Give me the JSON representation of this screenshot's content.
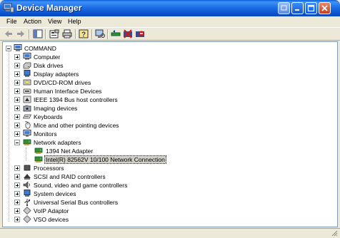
{
  "window": {
    "title": "Device Manager"
  },
  "menu": [
    "File",
    "Action",
    "View",
    "Help"
  ],
  "tree": {
    "root": "COMMAND",
    "categories": [
      {
        "label": "Computer",
        "icon": "computer-icon"
      },
      {
        "label": "Disk drives",
        "icon": "disk-drive-icon"
      },
      {
        "label": "Display adapters",
        "icon": "display-adapter-icon"
      },
      {
        "label": "DVD/CD-ROM drives",
        "icon": "cdrom-icon"
      },
      {
        "label": "Human Interface Devices",
        "icon": "hid-icon"
      },
      {
        "label": "IEEE 1394 Bus host controllers",
        "icon": "ieee1394-icon"
      },
      {
        "label": "Imaging devices",
        "icon": "camera-icon"
      },
      {
        "label": "Keyboards",
        "icon": "keyboard-icon"
      },
      {
        "label": "Mice and other pointing devices",
        "icon": "mouse-icon"
      },
      {
        "label": "Monitors",
        "icon": "monitor-icon"
      },
      {
        "label": "Network adapters",
        "icon": "network-adapter-icon",
        "expanded": true,
        "children": [
          {
            "label": "1394 Net Adapter",
            "icon": "network-card-icon"
          },
          {
            "label": "Intel(R) 82562V 10/100 Network Connection",
            "icon": "network-card-icon",
            "selected": true
          }
        ]
      },
      {
        "label": "Processors",
        "icon": "processor-icon"
      },
      {
        "label": "SCSI and RAID controllers",
        "icon": "scsi-icon"
      },
      {
        "label": "Sound, video and game controllers",
        "icon": "sound-icon"
      },
      {
        "label": "System devices",
        "icon": "system-device-icon"
      },
      {
        "label": "Universal Serial Bus controllers",
        "icon": "usb-icon"
      },
      {
        "label": "VoIP Adaptor",
        "icon": "voip-icon"
      },
      {
        "label": "VSO devices",
        "icon": "vso-icon"
      }
    ]
  },
  "colors": {
    "titlebar": "#0a54d2",
    "selection": "#d4d0c8",
    "tree_border": "#7f9db9"
  }
}
